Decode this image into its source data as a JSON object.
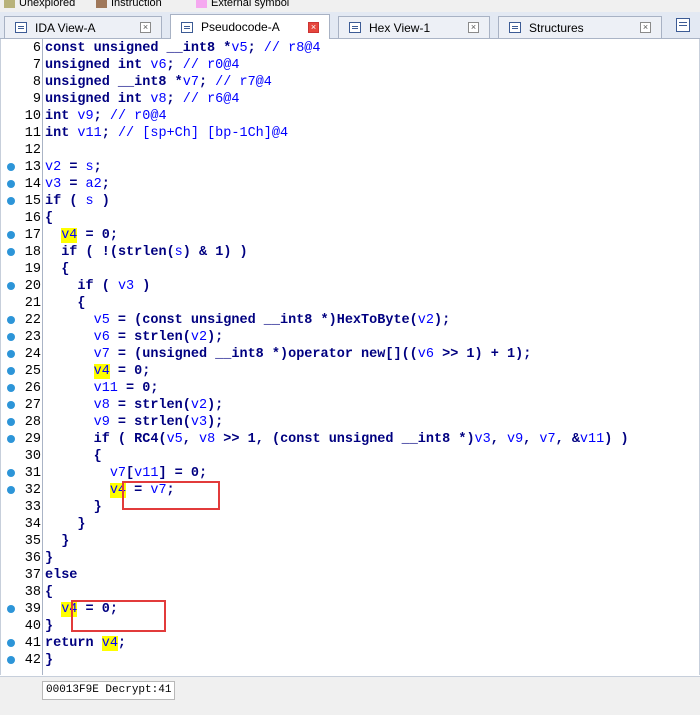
{
  "legend": [
    {
      "label": "Unexplored",
      "color": "#b8b27a"
    },
    {
      "label": "Instruction",
      "color": "#a0785a"
    },
    {
      "label": "External symbol",
      "color": "#f5a8f0"
    }
  ],
  "tabs": [
    {
      "label": "IDA View-A",
      "icon": "ida-view-icon",
      "close": "×"
    },
    {
      "label": "Pseudocode-A",
      "icon": "pseudocode-icon",
      "close": "×",
      "active": true
    },
    {
      "label": "Hex View-1",
      "icon": "hex-view-icon",
      "close": "×"
    },
    {
      "label": "Structures",
      "icon": "structures-icon",
      "close": "×"
    }
  ],
  "code_lines": [
    {
      "n": "6",
      "dot": false,
      "html": "const unsigned __int8 *v5; // r8@4"
    },
    {
      "n": "7",
      "dot": false,
      "html": "unsigned int v6; // r0@4"
    },
    {
      "n": "8",
      "dot": false,
      "html": "unsigned __int8 *v7; // r7@4"
    },
    {
      "n": "9",
      "dot": false,
      "html": "unsigned int v8; // r6@4"
    },
    {
      "n": "10",
      "dot": false,
      "html": "int v9; // r0@4"
    },
    {
      "n": "11",
      "dot": false,
      "html": "int v11; // [sp+Ch] [bp-1Ch]@4"
    },
    {
      "n": "12",
      "dot": false,
      "html": ""
    },
    {
      "n": "13",
      "dot": true,
      "html": "v2 = s;"
    },
    {
      "n": "14",
      "dot": true,
      "html": "v3 = a2;"
    },
    {
      "n": "15",
      "dot": true,
      "html": "if ( s )"
    },
    {
      "n": "16",
      "dot": false,
      "html": "{"
    },
    {
      "n": "17",
      "dot": true,
      "html": "  v4 = 0;"
    },
    {
      "n": "18",
      "dot": true,
      "html": "  if ( !(strlen(s) & 1) )"
    },
    {
      "n": "19",
      "dot": false,
      "html": "  {"
    },
    {
      "n": "20",
      "dot": true,
      "html": "    if ( v3 )"
    },
    {
      "n": "21",
      "dot": false,
      "html": "    {"
    },
    {
      "n": "22",
      "dot": true,
      "html": "      v5 = (const unsigned __int8 *)HexToByte(v2);"
    },
    {
      "n": "23",
      "dot": true,
      "html": "      v6 = strlen(v2);"
    },
    {
      "n": "24",
      "dot": true,
      "html": "      v7 = (unsigned __int8 *)operator new[]((v6 >> 1) + 1);"
    },
    {
      "n": "25",
      "dot": true,
      "html": "      v4 = 0;"
    },
    {
      "n": "26",
      "dot": true,
      "html": "      v11 = 0;"
    },
    {
      "n": "27",
      "dot": true,
      "html": "      v8 = strlen(v2);"
    },
    {
      "n": "28",
      "dot": true,
      "html": "      v9 = strlen(v3);"
    },
    {
      "n": "29",
      "dot": true,
      "html": "      if ( RC4(v5, v8 >> 1, (const unsigned __int8 *)v3, v9, v7, &v11) )"
    },
    {
      "n": "30",
      "dot": false,
      "html": "      {"
    },
    {
      "n": "31",
      "dot": true,
      "html": "        v7[v11] = 0;"
    },
    {
      "n": "32",
      "dot": true,
      "html": "        v4 = v7;"
    },
    {
      "n": "33",
      "dot": false,
      "html": "      }"
    },
    {
      "n": "34",
      "dot": false,
      "html": "    }"
    },
    {
      "n": "35",
      "dot": false,
      "html": "  }"
    },
    {
      "n": "36",
      "dot": false,
      "html": "}"
    },
    {
      "n": "37",
      "dot": false,
      "html": "else"
    },
    {
      "n": "38",
      "dot": false,
      "html": "{"
    },
    {
      "n": "39",
      "dot": true,
      "html": "  v4 = 0;"
    },
    {
      "n": "40",
      "dot": false,
      "html": "}"
    },
    {
      "n": "41",
      "dot": true,
      "html": "return v4;"
    },
    {
      "n": "42",
      "dot": true,
      "html": "}"
    }
  ],
  "status": {
    "address": "00013F9E",
    "location": "Decrypt:41"
  },
  "colors": {
    "keyword": "#000080",
    "variable": "#0000ff",
    "highlight": "#ffff00",
    "dot": "#2d95d8",
    "annotation_box": "#e23b3b"
  }
}
